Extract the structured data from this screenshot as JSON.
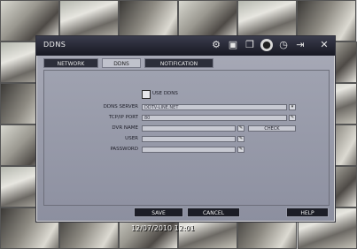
{
  "dialog": {
    "title": "DDNS"
  },
  "toolbar": {
    "icons": [
      "gear-icon",
      "save-icon",
      "copy-icon",
      "record-icon",
      "clock-icon",
      "exit-icon",
      "close-icon"
    ]
  },
  "tabs": [
    {
      "label": "NETWORK",
      "active": false
    },
    {
      "label": "DDNS",
      "active": true
    },
    {
      "label": "NOTIFICATION",
      "active": false
    }
  ],
  "form": {
    "use_ddns_label": "USE DDNS",
    "use_ddns_checked": false,
    "ddns_server_label": "DDNS SERVER",
    "ddns_server_value": "DDTV-LINE.NET",
    "tcp_port_label": "TCP/IP PORT",
    "tcp_port_value": "80",
    "dvr_name_label": "DVR NAME",
    "dvr_name_value": "",
    "check_label": "CHECK",
    "user_label": "USER",
    "user_value": "",
    "password_label": "PASSWORD",
    "password_value": ""
  },
  "buttons": {
    "save": "SAVE",
    "cancel": "CANCEL",
    "help": "HELP"
  },
  "status": {
    "timestamp": "12/07/2010 12:01"
  },
  "colors": {
    "titlebar": "#171822",
    "panel": "#9fa2b0",
    "accent": "#c0c2cc"
  }
}
